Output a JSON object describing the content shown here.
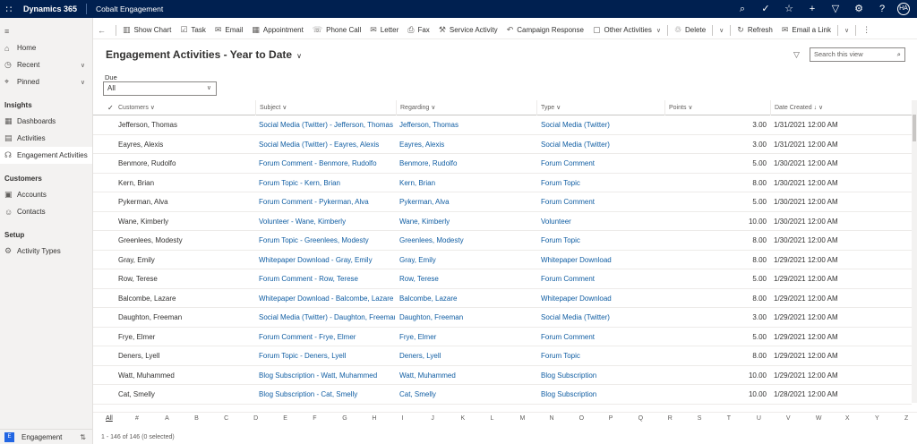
{
  "topbar": {
    "brand": "Dynamics 365",
    "app_name": "Cobalt Engagement",
    "avatar": "HA",
    "icons": [
      "search-icon",
      "task-check-icon",
      "lightbulb-icon",
      "plus-icon",
      "filter-icon",
      "settings-icon",
      "help-icon"
    ]
  },
  "sidebar": {
    "top_items": [
      {
        "label": "Home",
        "icon": "home-icon"
      },
      {
        "label": "Recent",
        "icon": "clock-icon"
      },
      {
        "label": "Pinned",
        "icon": "pin-icon"
      }
    ],
    "groups": [
      {
        "title": "Insights",
        "items": [
          {
            "label": "Dashboards",
            "icon": "dashboard-icon"
          },
          {
            "label": "Activities",
            "icon": "activities-icon"
          },
          {
            "label": "Engagement Activities",
            "icon": "engagement-icon",
            "selected": true
          }
        ]
      },
      {
        "title": "Customers",
        "items": [
          {
            "label": "Accounts",
            "icon": "accounts-icon"
          },
          {
            "label": "Contacts",
            "icon": "contacts-icon"
          }
        ]
      },
      {
        "title": "Setup",
        "items": [
          {
            "label": "Activity Types",
            "icon": "gear-icon"
          }
        ]
      }
    ],
    "footer": {
      "badge": "E",
      "label": "Engagement"
    }
  },
  "commands": [
    {
      "label": "Show Chart",
      "icon": "chart-icon"
    },
    {
      "label": "Task",
      "icon": "task-icon"
    },
    {
      "label": "Email",
      "icon": "email-icon"
    },
    {
      "label": "Appointment",
      "icon": "calendar-icon"
    },
    {
      "label": "Phone Call",
      "icon": "phone-icon"
    },
    {
      "label": "Letter",
      "icon": "letter-icon"
    },
    {
      "label": "Fax",
      "icon": "fax-icon"
    },
    {
      "label": "Service Activity",
      "icon": "service-icon"
    },
    {
      "label": "Campaign Response",
      "icon": "campaign-icon"
    },
    {
      "label": "Other Activities",
      "icon": "other-icon",
      "dropdown": true
    },
    {
      "label": "Delete",
      "icon": "delete-icon",
      "dropdown": true
    },
    {
      "label": "Refresh",
      "icon": "refresh-icon"
    },
    {
      "label": "Email a Link",
      "icon": "email-link-icon",
      "dropdown": true
    }
  ],
  "view": {
    "title": "Engagement Activities - Year to Date",
    "search_placeholder": "Search this view",
    "due_label": "Due",
    "due_value": "All"
  },
  "grid": {
    "columns": [
      "Customers",
      "Subject",
      "Regarding",
      "Type",
      "Points",
      "Date Created"
    ],
    "sort_indicator": "↓",
    "rows": [
      [
        "Jefferson, Thomas",
        "Social Media (Twitter) - Jefferson, Thomas",
        "Jefferson, Thomas",
        "Social Media (Twitter)",
        "3.00",
        "1/31/2021 12:00 AM"
      ],
      [
        "Eayres, Alexis",
        "Social Media (Twitter) - Eayres, Alexis",
        "Eayres, Alexis",
        "Social Media (Twitter)",
        "3.00",
        "1/31/2021 12:00 AM"
      ],
      [
        "Benmore, Rudolfo",
        "Forum Comment - Benmore, Rudolfo",
        "Benmore, Rudolfo",
        "Forum Comment",
        "5.00",
        "1/30/2021 12:00 AM"
      ],
      [
        "Kern, Brian",
        "Forum Topic - Kern, Brian",
        "Kern, Brian",
        "Forum Topic",
        "8.00",
        "1/30/2021 12:00 AM"
      ],
      [
        "Pykerman, Alva",
        "Forum Comment - Pykerman, Alva",
        "Pykerman, Alva",
        "Forum Comment",
        "5.00",
        "1/30/2021 12:00 AM"
      ],
      [
        "Wane, Kimberly",
        "Volunteer - Wane, Kimberly",
        "Wane, Kimberly",
        "Volunteer",
        "10.00",
        "1/30/2021 12:00 AM"
      ],
      [
        "Greenlees, Modesty",
        "Forum Topic - Greenlees, Modesty",
        "Greenlees, Modesty",
        "Forum Topic",
        "8.00",
        "1/30/2021 12:00 AM"
      ],
      [
        "Gray, Emily",
        "Whitepaper Download - Gray, Emily",
        "Gray, Emily",
        "Whitepaper Download",
        "8.00",
        "1/29/2021 12:00 AM"
      ],
      [
        "Row, Terese",
        "Forum Comment - Row, Terese",
        "Row, Terese",
        "Forum Comment",
        "5.00",
        "1/29/2021 12:00 AM"
      ],
      [
        "Balcombe, Lazare",
        "Whitepaper Download - Balcombe, Lazare",
        "Balcombe, Lazare",
        "Whitepaper Download",
        "8.00",
        "1/29/2021 12:00 AM"
      ],
      [
        "Daughton, Freeman",
        "Social Media (Twitter) - Daughton, Freeman",
        "Daughton, Freeman",
        "Social Media (Twitter)",
        "3.00",
        "1/29/2021 12:00 AM"
      ],
      [
        "Frye, Elmer",
        "Forum Comment - Frye, Elmer",
        "Frye, Elmer",
        "Forum Comment",
        "5.00",
        "1/29/2021 12:00 AM"
      ],
      [
        "Deners, Lyell",
        "Forum Topic - Deners, Lyell",
        "Deners, Lyell",
        "Forum Topic",
        "8.00",
        "1/29/2021 12:00 AM"
      ],
      [
        "Watt, Muhammed",
        "Blog Subscription - Watt, Muhammed",
        "Watt, Muhammed",
        "Blog Subscription",
        "10.00",
        "1/29/2021 12:00 AM"
      ],
      [
        "Cat, Smelly",
        "Blog Subscription - Cat, Smelly",
        "Cat, Smelly",
        "Blog Subscription",
        "10.00",
        "1/28/2021 12:00 AM"
      ]
    ]
  },
  "alpha_index": [
    "All",
    "#",
    "A",
    "B",
    "C",
    "D",
    "E",
    "F",
    "G",
    "H",
    "I",
    "J",
    "K",
    "L",
    "M",
    "N",
    "O",
    "P",
    "Q",
    "R",
    "S",
    "T",
    "U",
    "V",
    "W",
    "X",
    "Y",
    "Z"
  ],
  "footer_status": "1 - 146 of 146 (0 selected)"
}
